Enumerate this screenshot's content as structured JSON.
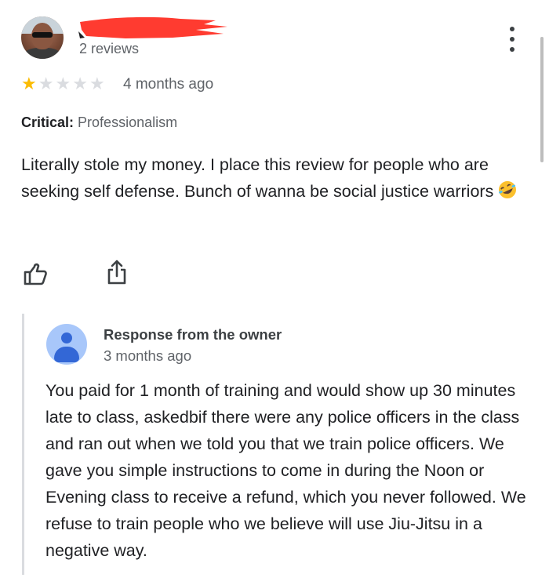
{
  "reviewer": {
    "reviews_count": "2 reviews"
  },
  "review": {
    "rating": 1,
    "rating_max": 5,
    "time_ago": "4 months ago",
    "critical_label": "Critical:",
    "critical_value": "Professionalism",
    "text": "Literally stole my money. I place this review for people who are seeking self defense. Bunch of wanna be social justice warriors",
    "emoji": "rolling-on-the-floor-laughing-emoji"
  },
  "actions": {
    "like_icon": "thumbs-up-icon",
    "share_icon": "share-icon",
    "menu_icon": "more-vert-icon"
  },
  "owner_response": {
    "title": "Response from the owner",
    "time_ago": "3 months ago",
    "text": "You paid for 1 month of training and would show up 30 minutes late to class, askedbif there were any police officers in the class and ran out when we told you that we train police officers. We gave you simple instructions to come in during the Noon or Evening class to receive a refund, which you never followed. We refuse to train people who we believe will use Jiu-Jitsu in a negative way."
  },
  "colors": {
    "star_filled": "#fbbc04",
    "star_empty": "#dadce0",
    "redaction": "#ff3b30",
    "owner_avatar_bg": "#a8c7fa",
    "owner_avatar_fg": "#3367d6"
  }
}
